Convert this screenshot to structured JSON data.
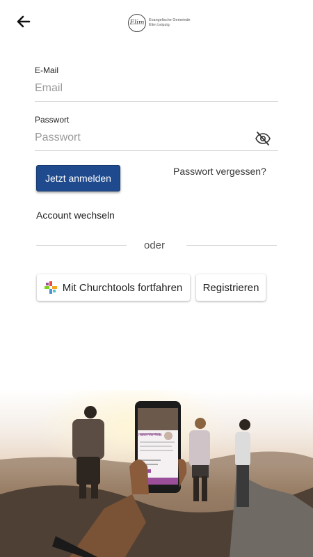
{
  "header": {
    "logo_mark": "Elim",
    "logo_line1": "Evangelische Gemeinde",
    "logo_line2": "Elim Leipzig"
  },
  "form": {
    "email_label": "E-Mail",
    "email_placeholder": "Email",
    "password_label": "Passwort",
    "password_placeholder": "Passwort",
    "login_button": "Jetzt anmelden",
    "forgot_password": "Passwort vergessen?",
    "switch_account": "Account wechseln",
    "divider": "oder",
    "churchtools_button": "Mit Churchtools fortfahren",
    "register_button": "Registrieren"
  },
  "phone_preview": {
    "name": "Rahel Vor Robi"
  },
  "colors": {
    "primary": "#1f4b8e",
    "accent_purple": "#9b4f9a"
  }
}
